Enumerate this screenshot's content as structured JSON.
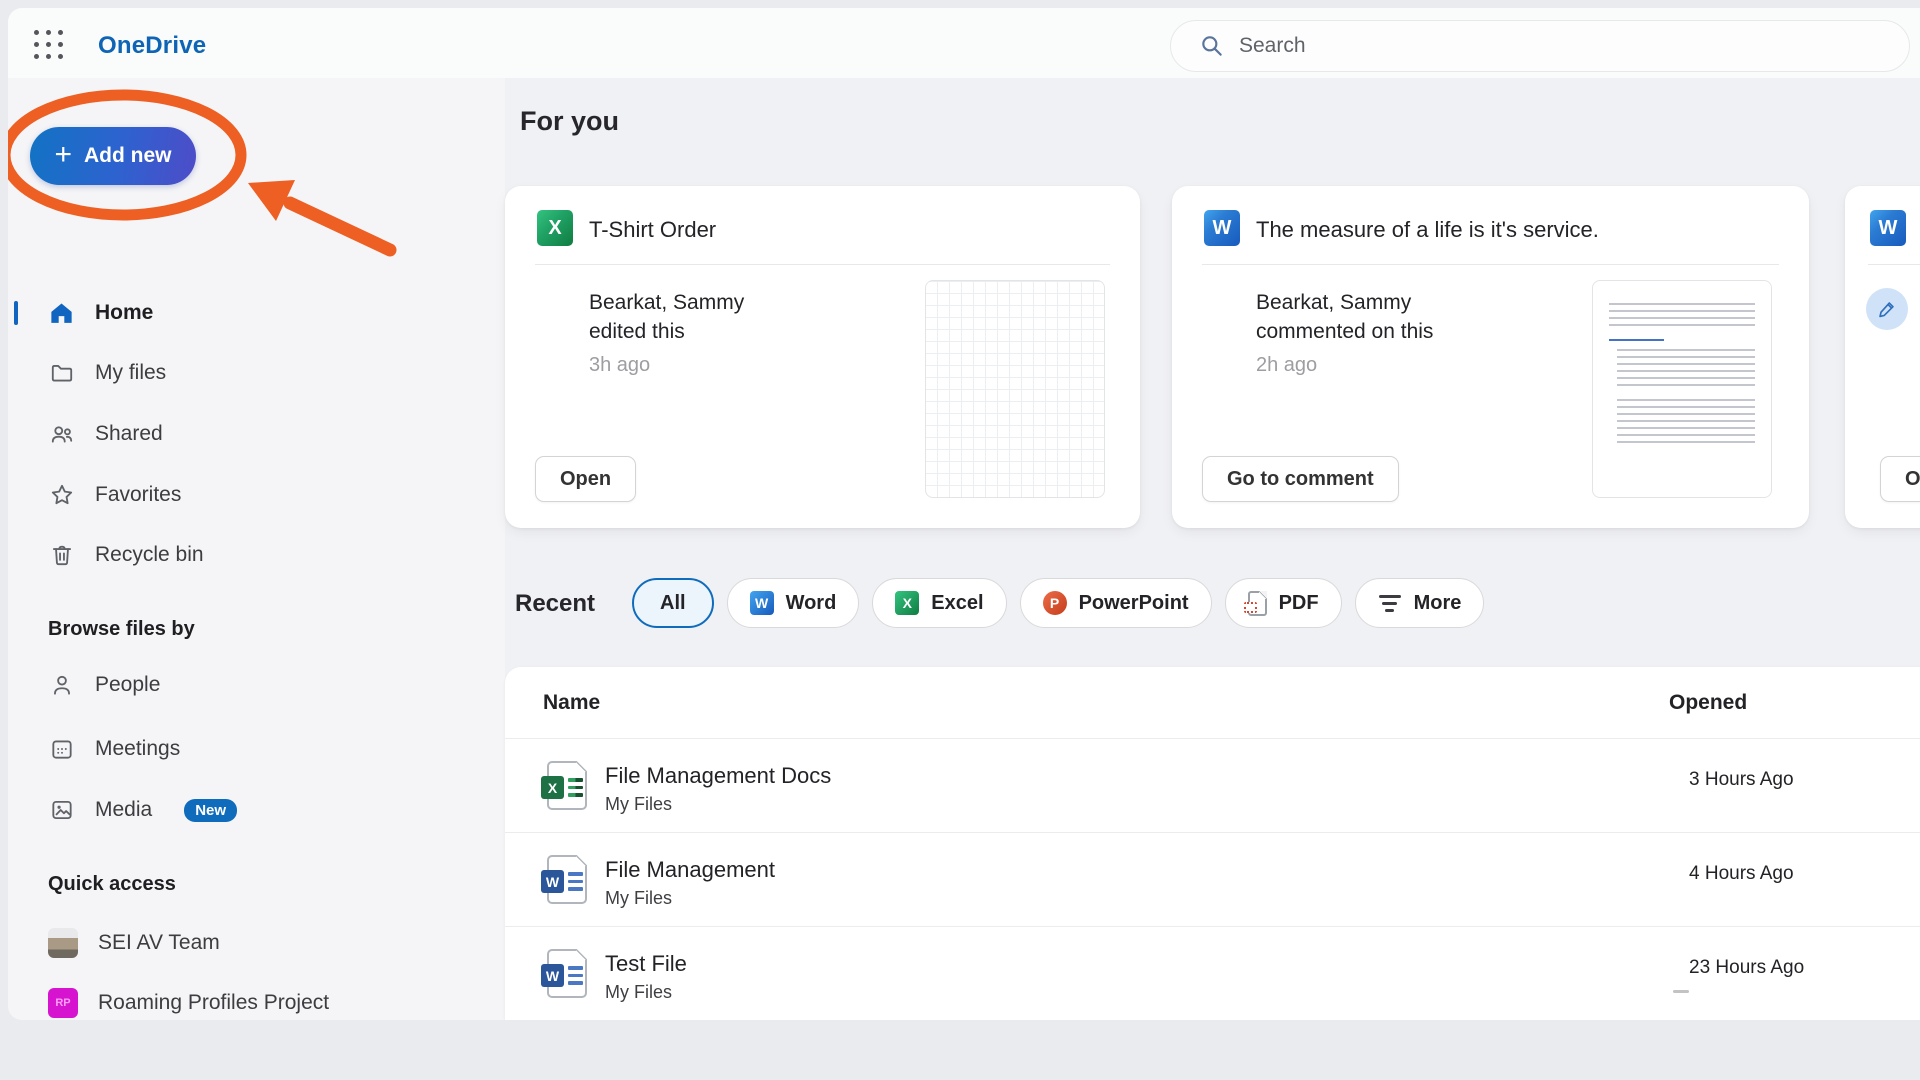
{
  "header": {
    "app_name": "OneDrive",
    "search_placeholder": "Search"
  },
  "sidebar": {
    "add_new_label": "Add new",
    "nav": [
      {
        "label": "Home",
        "icon": "home-icon",
        "active": true
      },
      {
        "label": "My files",
        "icon": "folder-icon",
        "active": false
      },
      {
        "label": "Shared",
        "icon": "people-icon",
        "active": false
      },
      {
        "label": "Favorites",
        "icon": "star-icon",
        "active": false
      },
      {
        "label": "Recycle bin",
        "icon": "trash-icon",
        "active": false
      }
    ],
    "browse_header": "Browse files by",
    "browse": [
      {
        "label": "People",
        "icon": "person-icon"
      },
      {
        "label": "Meetings",
        "icon": "calendar-icon"
      },
      {
        "label": "Media",
        "icon": "image-icon",
        "badge": "New"
      }
    ],
    "quick_header": "Quick access",
    "quick": [
      {
        "label": "SEI AV Team",
        "icon": "team-thumbnail"
      },
      {
        "label": "Roaming Profiles Project",
        "icon": "initials-tile",
        "initials": "RP"
      }
    ]
  },
  "for_you": {
    "title": "For you",
    "cards": [
      {
        "file_type": "excel",
        "icon_letter": "X",
        "title": "T-Shirt Order",
        "actor": "Bearkat, Sammy",
        "activity": "edited this",
        "time": "3h ago",
        "button": "Open",
        "thumbnail": "spreadsheet-grid"
      },
      {
        "file_type": "word",
        "icon_letter": "W",
        "title": "The measure of a life is it's service.",
        "actor": "Bearkat, Sammy",
        "activity": "commented on this",
        "time": "2h ago",
        "button": "Go to comment",
        "thumbnail": "document-text"
      },
      {
        "file_type": "word",
        "icon_letter": "W",
        "button": "Open",
        "thumbnail": "edit-badge"
      }
    ]
  },
  "recent": {
    "title": "Recent",
    "filters": [
      {
        "label": "All",
        "selected": true
      },
      {
        "label": "Word",
        "icon": "word-icon",
        "letter": "W"
      },
      {
        "label": "Excel",
        "icon": "excel-icon",
        "letter": "X"
      },
      {
        "label": "PowerPoint",
        "icon": "powerpoint-icon",
        "letter": "P"
      },
      {
        "label": "PDF",
        "icon": "pdf-icon"
      },
      {
        "label": "More",
        "icon": "filter-icon"
      }
    ],
    "table": {
      "columns": [
        "Name",
        "Opened"
      ],
      "rows": [
        {
          "name": "File Management Docs",
          "location": "My Files",
          "opened": "3 Hours Ago",
          "file_type": "excel",
          "icon_letter": "X"
        },
        {
          "name": "File Management",
          "location": "My Files",
          "opened": "4 Hours Ago",
          "file_type": "word",
          "icon_letter": "W"
        },
        {
          "name": "Test File",
          "location": "My Files",
          "opened": "23 Hours Ago",
          "file_type": "word",
          "icon_letter": "W"
        }
      ]
    }
  },
  "annotation": {
    "shape": "ellipse-with-arrow",
    "color": "#ee5f23"
  },
  "colors": {
    "brand_blue": "#0f6cbd",
    "add_new_gradient_start": "#1273c4",
    "add_new_gradient_end": "#4e4cc8",
    "badge_new": "#0f6cbd",
    "excel_green": "#107c41",
    "word_blue": "#185abd",
    "powerpoint_red": "#c43e1c",
    "pdf_red": "#d6452e",
    "annotation_orange": "#ee5f23"
  }
}
